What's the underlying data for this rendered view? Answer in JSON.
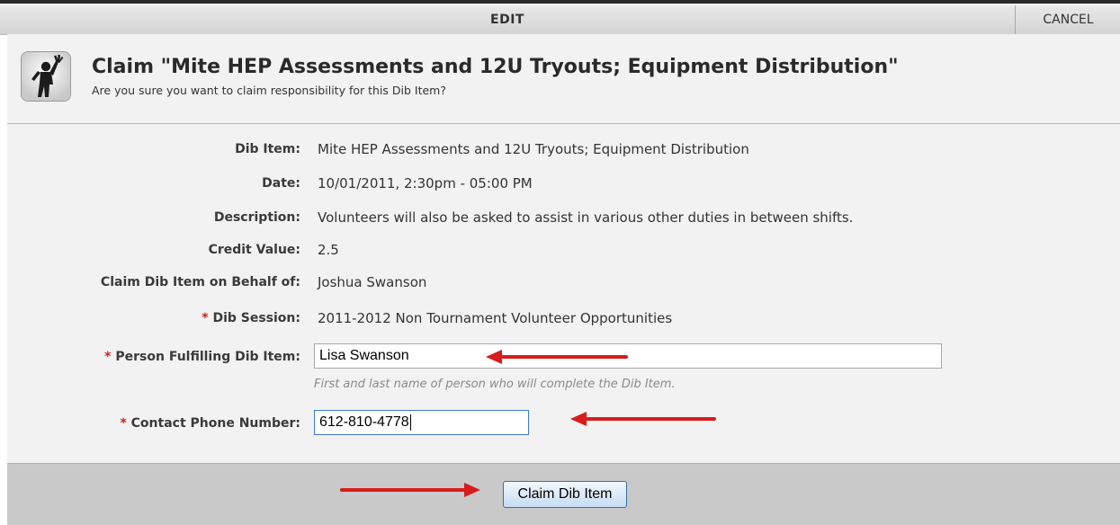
{
  "toolbar": {
    "edit_label": "EDIT",
    "cancel_label": "CANCEL"
  },
  "header": {
    "title": "Claim \"Mite HEP Assessments and 12U Tryouts; Equipment Distribution\"",
    "subtitle": "Are you sure you want to claim responsibility for this Dib Item?",
    "icon": "volunteer-hand-raised-icon"
  },
  "details": {
    "dib_item": {
      "label": "Dib Item:",
      "value": "Mite HEP Assessments and 12U Tryouts; Equipment Distribution"
    },
    "date": {
      "label": "Date:",
      "value": "10/01/2011, 2:30pm - 05:00 PM"
    },
    "description": {
      "label": "Description:",
      "value": "Volunteers will also be asked to assist in various other duties in between shifts."
    },
    "credit_value": {
      "label": "Credit Value:",
      "value": "2.5"
    },
    "behalf_of": {
      "label": "Claim Dib Item on Behalf of:",
      "value": "Joshua Swanson"
    },
    "dib_session": {
      "required": "*",
      "label": "Dib Session:",
      "value": "2011-2012 Non Tournament Volunteer Opportunities"
    }
  },
  "form": {
    "person": {
      "required": "*",
      "label": "Person Fulfilling Dib Item:",
      "value": "Lisa Swanson",
      "hint": "First and last name of person who will complete the Dib Item."
    },
    "phone": {
      "required": "*",
      "label": "Contact Phone Number:",
      "value": "612-810-4778"
    }
  },
  "actions": {
    "claim_label": "Claim Dib Item"
  },
  "colors": {
    "required": "#d02020",
    "annotation_arrow": "#d81c1c",
    "button_border": "#3b6ea5"
  }
}
